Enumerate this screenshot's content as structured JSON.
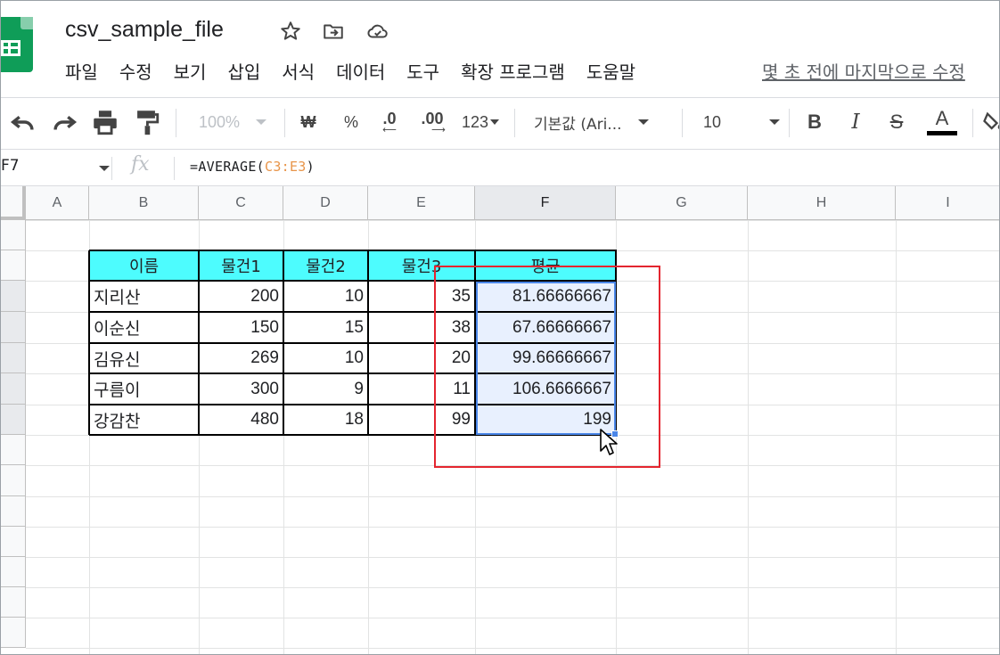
{
  "app": {
    "doc_title": "csv_sample_file",
    "menu": [
      "파일",
      "수정",
      "보기",
      "삽입",
      "서식",
      "데이터",
      "도구",
      "확장 프로그램",
      "도움말"
    ],
    "last_edit": "몇 초 전에 마지막으로 수정"
  },
  "toolbar": {
    "zoom": "100%",
    "currency": "₩",
    "percent": "%",
    "dec_decrease": ".0",
    "dec_increase": ".00",
    "more_formats": "123",
    "font": "기본값 (Ari...",
    "font_size": "10",
    "bold": "B",
    "italic": "I",
    "strike": "S",
    "text_color": "A"
  },
  "formula_bar": {
    "name_box": "F7",
    "fx": "fx",
    "formula_prefix": "=AVERAGE(",
    "formula_ref": "C3:E3",
    "formula_suffix": ")"
  },
  "columns": [
    "A",
    "B",
    "C",
    "D",
    "E",
    "F",
    "G",
    "H",
    "I"
  ],
  "table": {
    "headers": [
      "이름",
      "물건1",
      "물건2",
      "물건3",
      "평균"
    ],
    "rows": [
      {
        "name": "지리산",
        "v1": "200",
        "v2": "10",
        "v3": "35",
        "avg": "81.66666667"
      },
      {
        "name": "이순신",
        "v1": "150",
        "v2": "15",
        "v3": "38",
        "avg": "67.66666667"
      },
      {
        "name": "김유신",
        "v1": "269",
        "v2": "10",
        "v3": "20",
        "avg": "99.66666667"
      },
      {
        "name": "구름이",
        "v1": "300",
        "v2": "9",
        "v3": "11",
        "avg": "106.6666667"
      },
      {
        "name": "강감찬",
        "v1": "480",
        "v2": "18",
        "v3": "99",
        "avg": "199"
      }
    ]
  },
  "colors": {
    "header_fill": "#4dfcfe",
    "selection": "#4a86e8",
    "highlight_box": "#e4252f",
    "brand": "#0f9d58"
  }
}
